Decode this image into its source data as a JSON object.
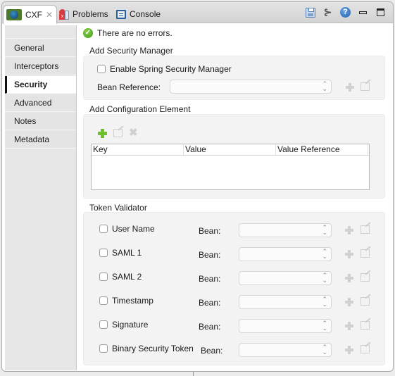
{
  "tabs": [
    {
      "label": "CXF",
      "icon": "cxf-globe-icon",
      "active": true,
      "closable": true
    },
    {
      "label": "Problems",
      "icon": "problems-icon",
      "active": false
    },
    {
      "label": "Console",
      "icon": "console-icon",
      "active": false
    }
  ],
  "toolbar": {
    "icons": [
      "save-icon",
      "tree-icon",
      "help-icon",
      "minimize-icon",
      "maximize-icon"
    ],
    "help_glyph": "?",
    "close_glyph": "✕"
  },
  "sidebar": {
    "items": [
      {
        "label": "General"
      },
      {
        "label": "Interceptors"
      },
      {
        "label": "Security",
        "active": true
      },
      {
        "label": "Advanced"
      },
      {
        "label": "Notes"
      },
      {
        "label": "Metadata"
      }
    ]
  },
  "status": {
    "icon": "check-circle-icon",
    "text": "There are no errors."
  },
  "security_manager": {
    "title": "Add Security Manager",
    "enable_label": "Enable Spring Security Manager",
    "enable_checked": false,
    "bean_ref_label": "Bean Reference:",
    "bean_ref_value": ""
  },
  "config_element": {
    "title": "Add Configuration Element",
    "columns": [
      "Key",
      "Value",
      "Value Reference"
    ],
    "rows": []
  },
  "token_validator": {
    "title": "Token Validator",
    "bean_label": "Bean:",
    "items": [
      {
        "label": "User Name",
        "checked": false,
        "bean": ""
      },
      {
        "label": "SAML 1",
        "checked": false,
        "bean": ""
      },
      {
        "label": "SAML 2",
        "checked": false,
        "bean": ""
      },
      {
        "label": "Timestamp",
        "checked": false,
        "bean": ""
      },
      {
        "label": "Signature",
        "checked": false,
        "bean": ""
      },
      {
        "label": "Binary Security Token",
        "checked": false,
        "bean": ""
      }
    ]
  }
}
